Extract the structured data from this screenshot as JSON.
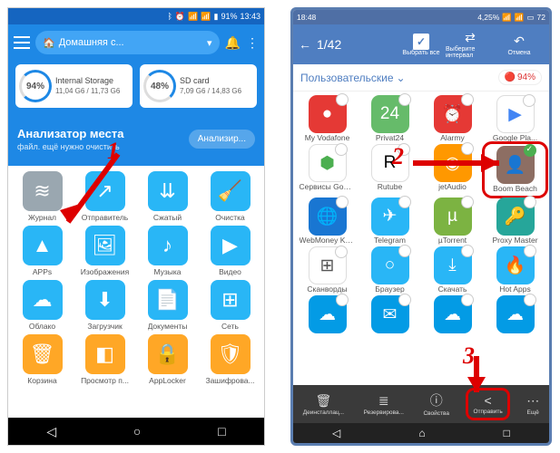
{
  "left": {
    "status": {
      "battery": "91%",
      "time": "13:43"
    },
    "breadcrumb": "Домашняя с...",
    "storage": [
      {
        "pct": "94%",
        "label": "Internal Storage",
        "used": "11,04 G6 / 11,73 G6"
      },
      {
        "pct": "48%",
        "label": "SD card",
        "used": "7,09 G6 / 14,83 G6"
      }
    ],
    "analyzer": {
      "title": "Анализатор места",
      "sub": "файл. ещё нужно очистить",
      "btn": "Анализир..."
    },
    "apps": [
      {
        "lbl": "Журнал",
        "bg": "#9aa7b0",
        "glyph": "≋"
      },
      {
        "lbl": "Отправитель",
        "bg": "#29b6f6",
        "glyph": "↗"
      },
      {
        "lbl": "Сжатый",
        "bg": "#29b6f6",
        "glyph": "⇊"
      },
      {
        "lbl": "Очистка",
        "bg": "#29b6f6",
        "glyph": "🧹"
      },
      {
        "lbl": "APPs",
        "bg": "#29b6f6",
        "glyph": "▲"
      },
      {
        "lbl": "Изображения",
        "bg": "#29b6f6",
        "glyph": "🖼"
      },
      {
        "lbl": "Музыка",
        "bg": "#29b6f6",
        "glyph": "♪"
      },
      {
        "lbl": "Видео",
        "bg": "#29b6f6",
        "glyph": "▶"
      },
      {
        "lbl": "Облако",
        "bg": "#29b6f6",
        "glyph": "☁"
      },
      {
        "lbl": "Загрузчик",
        "bg": "#29b6f6",
        "glyph": "⬇"
      },
      {
        "lbl": "Документы",
        "bg": "#29b6f6",
        "glyph": "📄"
      },
      {
        "lbl": "Сеть",
        "bg": "#29b6f6",
        "glyph": "⊞"
      },
      {
        "lbl": "Корзина",
        "bg": "#ffa726",
        "glyph": "🗑"
      },
      {
        "lbl": "Просмотр п...",
        "bg": "#ffa726",
        "glyph": "◧"
      },
      {
        "lbl": "AppLocker",
        "bg": "#ffa726",
        "glyph": "🔒"
      },
      {
        "lbl": "Зашифрова...",
        "bg": "#ffa726",
        "glyph": "🛡"
      }
    ]
  },
  "right": {
    "status": {
      "time": "18:48",
      "pct": "4,25%",
      "batt": "72"
    },
    "selectbar": {
      "count": "1/42",
      "selectAll": "Выбрать все",
      "selectInterval": "Выберите интервал",
      "cancel": "Отмена"
    },
    "filter": {
      "label": "Пользовательские",
      "badge": "94%"
    },
    "apps": [
      {
        "lbl": "My Vodafone",
        "bg": "#e53935",
        "glyph": "●"
      },
      {
        "lbl": "Privat24",
        "bg": "#66bb6a",
        "glyph": "24"
      },
      {
        "lbl": "Alarmy",
        "bg": "#e53935",
        "glyph": "⏰"
      },
      {
        "lbl": "Google Pla...",
        "bg": "#fff",
        "glyph": "▶",
        "fg": "#4285f4"
      },
      {
        "lbl": "Сервисы Google",
        "bg": "#fff",
        "glyph": "⬢",
        "fg": "#4caf50"
      },
      {
        "lbl": "Rutube",
        "bg": "#fff",
        "glyph": "R",
        "fg": "#000"
      },
      {
        "lbl": "jetAudio",
        "bg": "#ff9800",
        "glyph": "◉"
      },
      {
        "lbl": "Boom Beach",
        "bg": "#8d6e63",
        "glyph": "👤",
        "selected": true
      },
      {
        "lbl": "WebMoney Keeper",
        "bg": "#1976d2",
        "glyph": "🌐"
      },
      {
        "lbl": "Telegram",
        "bg": "#29b6f6",
        "glyph": "✈"
      },
      {
        "lbl": "µTorrent",
        "bg": "#7cb342",
        "glyph": "µ"
      },
      {
        "lbl": "Proxy Master",
        "bg": "#26a69a",
        "glyph": "🔑"
      },
      {
        "lbl": "Сканворды",
        "bg": "#fff",
        "glyph": "⊞",
        "fg": "#555"
      },
      {
        "lbl": "Браузер",
        "bg": "#29b6f6",
        "glyph": "○"
      },
      {
        "lbl": "Скачать",
        "bg": "#29b6f6",
        "glyph": "⤓"
      },
      {
        "lbl": "Hot Apps",
        "bg": "#29b6f6",
        "glyph": "🔥"
      },
      {
        "lbl": "",
        "bg": "#039be5",
        "glyph": "☁"
      },
      {
        "lbl": "",
        "bg": "#039be5",
        "glyph": "✉"
      },
      {
        "lbl": "",
        "bg": "#039be5",
        "glyph": "☁"
      },
      {
        "lbl": "",
        "bg": "#039be5",
        "glyph": "☁"
      }
    ],
    "bottombar": [
      {
        "lbl": "Деинсталлац...",
        "glyph": "🗑"
      },
      {
        "lbl": "Резервирова...",
        "glyph": "≣"
      },
      {
        "lbl": "Свойства",
        "glyph": "ⓘ"
      },
      {
        "lbl": "Отправить",
        "glyph": "<",
        "highlighted": true
      },
      {
        "lbl": "Ещё",
        "glyph": "⋯"
      }
    ]
  },
  "annotations": {
    "n1": "1",
    "n2": "2",
    "n3": "3"
  }
}
